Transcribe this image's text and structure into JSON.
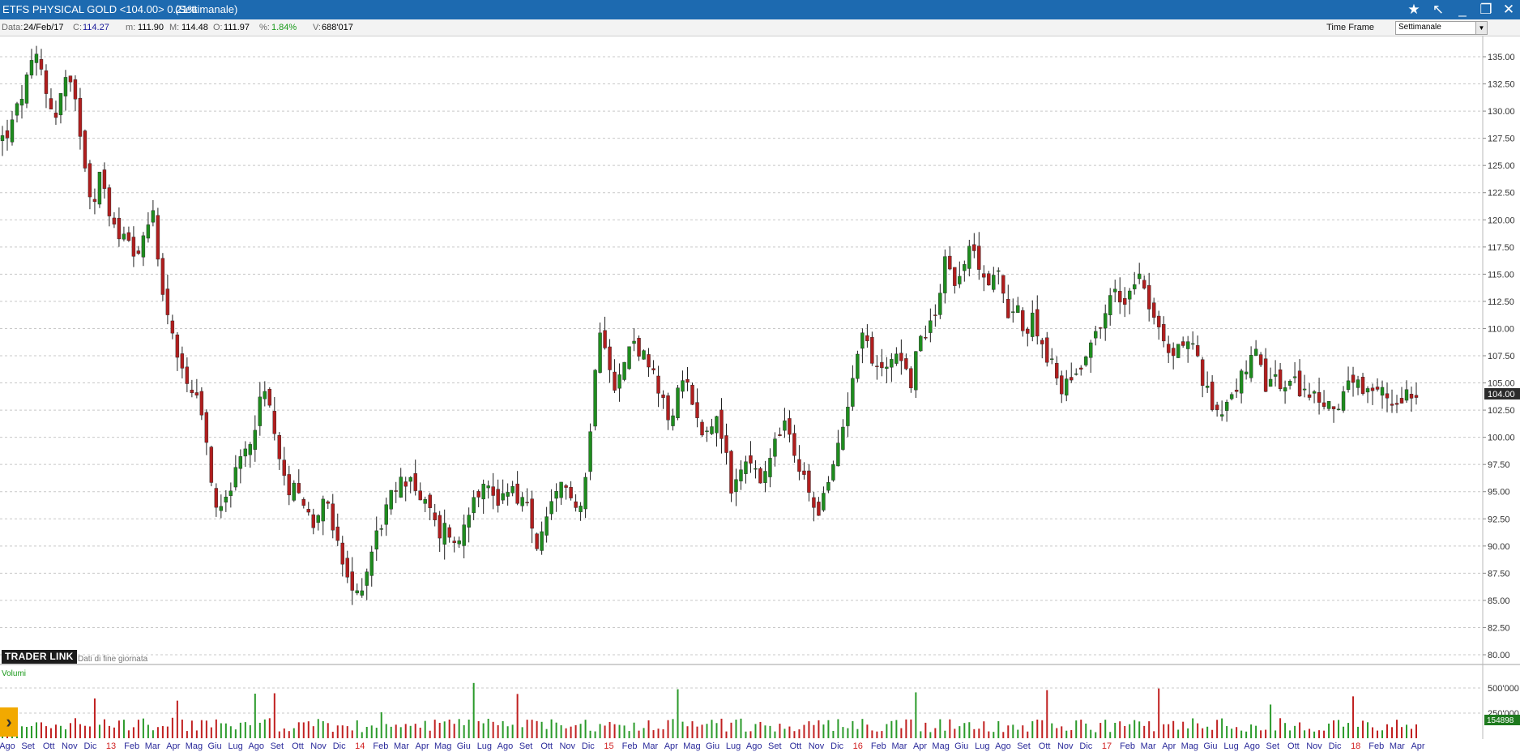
{
  "titlebar": {
    "title": "ETFS PHYSICAL GOLD <104.00> 0.21%",
    "timeframe": "(Settimanale)",
    "icons": [
      "star-icon",
      "pin-icon",
      "minimize-icon",
      "restore-icon",
      "close-icon"
    ]
  },
  "infobar": {
    "data_label": "Data:",
    "data_value": "24/Feb/17",
    "c_label": "C:",
    "c_value": "114.27",
    "m_label": "m:",
    "m_value": "111.90",
    "M_label": "M:",
    "M_value": "114.48",
    "o_label": "O:",
    "o_value": "111.97",
    "pct_label": "%:",
    "pct_value": "1.84%",
    "v_label": "V:",
    "v_value": "688'017",
    "timeframe_label": "Time Frame",
    "timeframe_value": "Settimanale"
  },
  "branding": {
    "logo": "TRADER LINK",
    "subtitle": "Dati di fine giornata"
  },
  "volume_panel": {
    "label": "Volumi"
  },
  "colors": {
    "up": "#1e8c1e",
    "down": "#b01e1e",
    "wick": "#202020",
    "accent": "#1d6ab0"
  },
  "chart_data": {
    "type": "candlestick",
    "instrument": "ETFS PHYSICAL GOLD",
    "last_price": "104.00",
    "ylim": [
      80.0,
      136.5
    ],
    "y_ticks": [
      "135.00",
      "132.50",
      "130.00",
      "127.50",
      "125.00",
      "122.50",
      "120.00",
      "117.50",
      "115.00",
      "112.50",
      "110.00",
      "107.50",
      "105.00",
      "102.50",
      "100.00",
      "97.50",
      "95.00",
      "92.50",
      "90.00",
      "87.50",
      "85.00",
      "82.50",
      "80.00"
    ],
    "volume_ticks": [
      "500'000",
      "250'000"
    ],
    "last_volume": "154898",
    "x_ticks": [
      "Ago",
      "Set",
      "Ott",
      "Nov",
      "Dic",
      "13",
      "Feb",
      "Mar",
      "Apr",
      "Mag",
      "Giu",
      "Lug",
      "Ago",
      "Set",
      "Ott",
      "Nov",
      "Dic",
      "14",
      "Feb",
      "Mar",
      "Apr",
      "Mag",
      "Giu",
      "Lug",
      "Ago",
      "Set",
      "Ott",
      "Nov",
      "Dic",
      "15",
      "Feb",
      "Mar",
      "Apr",
      "Mag",
      "Giu",
      "Lug",
      "Ago",
      "Set",
      "Ott",
      "Nov",
      "Dic",
      "16",
      "Feb",
      "Mar",
      "Apr",
      "Mag",
      "Giu",
      "Lug",
      "Ago",
      "Set",
      "Ott",
      "Nov",
      "Dic",
      "17",
      "Feb",
      "Mar",
      "Apr",
      "Mag",
      "Giu",
      "Lug",
      "Ago",
      "Set",
      "Ott",
      "Nov",
      "Dic",
      "18",
      "Feb",
      "Mar",
      "Apr"
    ],
    "year_ticks": [
      "13",
      "14",
      "15",
      "16",
      "17",
      "18"
    ],
    "close_path": [
      127.5,
      128.5,
      131,
      133.5,
      135,
      131.5,
      129.5,
      133,
      131.5,
      127,
      121.5,
      124,
      121,
      118,
      119.5,
      116.5,
      118,
      121,
      113,
      110.5,
      106,
      104,
      103,
      99,
      93.5,
      95,
      96,
      98,
      100,
      103.5,
      104,
      98,
      95,
      96.5,
      93.5,
      92,
      95,
      92,
      89,
      86,
      85.5,
      88,
      91,
      93,
      95,
      96,
      96.5,
      94,
      93.5,
      91,
      92,
      89.5,
      92.5,
      95,
      95.5,
      95,
      94,
      96,
      94.5,
      93.5,
      90,
      91.5,
      94,
      95.5,
      95,
      93.5,
      99,
      111,
      108,
      104.5,
      107,
      109,
      107.5,
      106,
      103.5,
      101.5,
      104,
      106,
      101.5,
      100.5,
      102,
      100,
      95,
      97,
      98.5,
      95.5,
      97,
      99.5,
      101.5,
      98,
      96.5,
      94,
      93.5,
      96,
      99,
      103,
      108,
      110,
      106,
      106.5,
      107.5,
      108,
      104.5,
      108.5,
      110,
      111.5,
      117,
      114,
      116.5,
      117,
      116,
      114,
      115,
      111,
      113,
      109,
      111,
      108.5,
      106.5,
      104.5,
      105.5,
      106,
      108.5,
      109.5,
      111.5,
      113.5,
      112,
      114.5,
      115.5,
      112,
      110,
      107.5,
      108,
      109,
      108.5,
      105,
      103,
      102.5,
      104,
      105,
      106.5,
      107.5,
      104.5,
      105.5,
      104.5,
      105,
      104.5,
      104,
      103.5,
      102.5,
      103,
      104.5,
      105,
      104,
      103.5,
      104.5,
      103,
      103.5,
      104.5,
      104
    ]
  }
}
